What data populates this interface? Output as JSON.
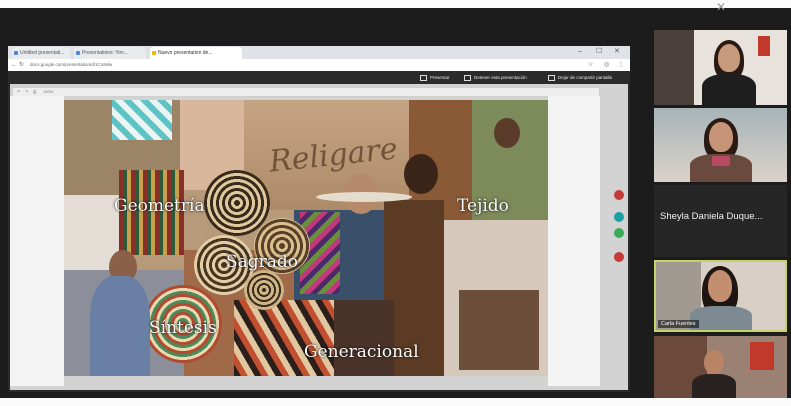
{
  "window": {
    "close_glyph": "✕"
  },
  "browser": {
    "tabs": [
      {
        "label": "Untitled presentati..."
      },
      {
        "label": "Presentations: Yim..."
      },
      {
        "label": "Nuevo presentation de..."
      }
    ],
    "address": "docs.google.com/presentation/d/1Co9slw",
    "share_bar": {
      "item_1": "Presentar",
      "item_2": "Detener esta presentación",
      "item_3": "Dejar de compartir pantalla"
    },
    "slide_toolbar_items": [
      "↶",
      "↷",
      "⎙",
      "100%"
    ]
  },
  "slide": {
    "script_title": "Religare",
    "words": {
      "geometria": "Geometría",
      "tejido": "Tejido",
      "sagrado": "Sagrado",
      "sintesis": "Síntesis",
      "generacional": "Generacional"
    }
  },
  "participants": [
    {
      "name": ""
    },
    {
      "name": ""
    },
    {
      "name": "Sheyla Daniela Duque..."
    },
    {
      "name": "Carla Fuentes"
    },
    {
      "name": ""
    }
  ],
  "colors": {
    "speaker_border": "#c6d36b",
    "tool_red": "#c63a3a",
    "tool_teal": "#1aa0a3",
    "tool_green": "#3aa95a"
  }
}
